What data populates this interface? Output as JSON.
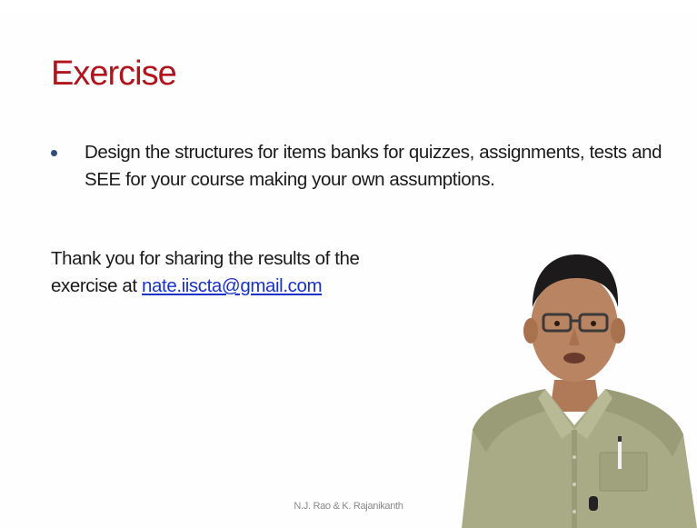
{
  "slide": {
    "title": "Exercise",
    "bullets": [
      "Design the structures for items banks for quizzes, assignments, tests and SEE for your course making your own assumptions."
    ],
    "thanks_text": "Thank you for sharing the results of the exercise at ",
    "email": "nate.iiscta@gmail.com",
    "footer": "N.J. Rao & K. Rajanikanth"
  },
  "colors": {
    "title": "#b0141c",
    "bullet": "#2e4b7a",
    "link": "#1a32c8",
    "background": "#fefefe"
  }
}
